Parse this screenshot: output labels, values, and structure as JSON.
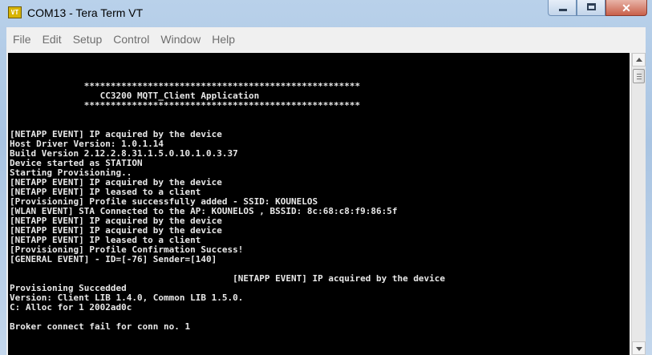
{
  "window": {
    "title": "COM13 - Tera Term VT",
    "icon_text": "VT",
    "icon": "teraterm-app-icon"
  },
  "menu": {
    "items": [
      "File",
      "Edit",
      "Setup",
      "Control",
      "Window",
      "Help"
    ]
  },
  "terminal": {
    "lines": [
      "              ****************************************************",
      "                 CC3200 MQTT_Client Application",
      "              ****************************************************",
      "",
      "",
      "[NETAPP EVENT] IP acquired by the device",
      "Host Driver Version: 1.0.1.14",
      "Build Version 2.12.2.8.31.1.5.0.10.1.0.3.37",
      "Device started as STATION",
      "Starting Provisioning..",
      "[NETAPP EVENT] IP acquired by the device",
      "[NETAPP EVENT] IP leased to a client",
      "[Provisioning] Profile successfully added - SSID: KOUNELOS",
      "[WLAN EVENT] STA Connected to the AP: KOUNELOS , BSSID: 8c:68:c8:f9:86:5f",
      "[NETAPP EVENT] IP acquired by the device",
      "[NETAPP EVENT] IP acquired by the device",
      "[NETAPP EVENT] IP leased to a client",
      "[Provisioning] Profile Confirmation Success!",
      "[GENERAL EVENT] - ID=[-76] Sender=[140]",
      "",
      "                                          [NETAPP EVENT] IP acquired by the device",
      "Provisioning Succedded",
      "Version: Client LIB 1.4.0, Common LIB 1.5.0.",
      "C: Alloc for 1 2002ad0c",
      "",
      "Broker connect fail for conn no. 1"
    ]
  }
}
